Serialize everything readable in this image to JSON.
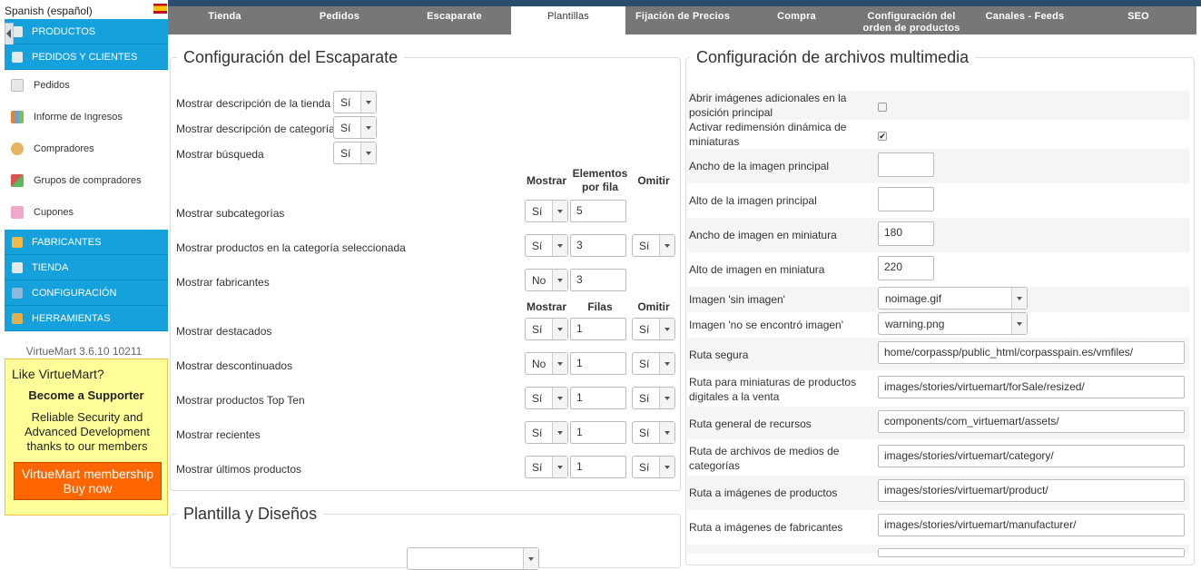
{
  "language": {
    "label": "Spanish (español)",
    "flag_icon": "spain-flag-icon"
  },
  "sidebar": {
    "products": "PRODUCTOS",
    "orders_customers": "PEDIDOS Y CLIENTES",
    "sub_items": [
      {
        "label": "Pedidos",
        "icon": "orders-icon"
      },
      {
        "label": "Informe de Ingresos",
        "icon": "chart-icon"
      },
      {
        "label": "Compradores",
        "icon": "users-icon"
      },
      {
        "label": "Grupos de compradores",
        "icon": "groups-icon"
      },
      {
        "label": "Cupones",
        "icon": "gift-icon"
      }
    ],
    "manufacturers": "FABRICANTES",
    "store": "TIENDA",
    "configuration": "CONFIGURACIÓN",
    "tools": "HERRAMIENTAS",
    "version": "VirtueMart 3.6.10 10211"
  },
  "promo": {
    "like": "Like VirtueMart?",
    "supporter": "Become a Supporter",
    "text": "Reliable Security and Advanced Development thanks to our members",
    "button": "VirtueMart membership Buy now"
  },
  "tabs": [
    "Tienda",
    "Pedidos",
    "Escaparate",
    "Plantillas",
    "Fijación de Precios",
    "Compra",
    "Configuración del orden de productos",
    "Canales - Feeds",
    "SEO"
  ],
  "active_tab": "Plantillas",
  "storefront": {
    "title": "Configuración del Escaparate",
    "rows": [
      {
        "label": "Mostrar descripción de la tienda",
        "value": "Sí"
      },
      {
        "label": "Mostrar descripción de categoría",
        "value": "Sí"
      },
      {
        "label": "Mostrar búsqueda",
        "value": "Sí"
      }
    ],
    "headers1": {
      "show": "Mostrar",
      "per_row": "Elementos por fila",
      "omit": "Omitir"
    },
    "group1": [
      {
        "label": "Mostrar subcategorías",
        "show": "Sí",
        "count": "5",
        "omit": ""
      },
      {
        "label": "Mostrar productos en la categoría seleccionada",
        "show": "Sí",
        "count": "3",
        "omit": "Sí"
      },
      {
        "label": "Mostrar fabricantes",
        "show": "No",
        "count": "3",
        "omit": ""
      }
    ],
    "headers2": {
      "show": "Mostrar",
      "rows": "Filas",
      "omit": "Omitir"
    },
    "group2": [
      {
        "label": "Mostrar destacados",
        "show": "Sí",
        "count": "1",
        "omit": "Sí"
      },
      {
        "label": "Mostrar descontinuados",
        "show": "No",
        "count": "1",
        "omit": "Sí"
      },
      {
        "label": "Mostrar productos Top Ten",
        "show": "Sí",
        "count": "1",
        "omit": "Sí"
      },
      {
        "label": "Mostrar recientes",
        "show": "Sí",
        "count": "1",
        "omit": "Sí"
      },
      {
        "label": "Mostrar últimos productos",
        "show": "Sí",
        "count": "1",
        "omit": "Sí"
      }
    ]
  },
  "templates": {
    "title": "Plantilla y Diseños"
  },
  "media": {
    "title": "Configuración de archivos multimedia",
    "open_additional": {
      "label": "Abrir imágenes adicionales en la posición principal",
      "checked": false
    },
    "dynamic_resize": {
      "label": "Activar redimensión dinámica de miniaturas",
      "checked": true
    },
    "fields": [
      {
        "label": "Ancho de la imagen principal",
        "value": ""
      },
      {
        "label": "Alto de la imagen principal",
        "value": ""
      },
      {
        "label": "Ancho de imagen en miniatura",
        "value": "180"
      },
      {
        "label": "Alto de imagen en miniatura",
        "value": "220"
      }
    ],
    "selects": [
      {
        "label": "Imagen 'sin imagen'",
        "value": "noimage.gif"
      },
      {
        "label": "Imagen 'no se encontró imagen'",
        "value": "warning.png"
      }
    ],
    "paths": [
      {
        "label": "Ruta segura",
        "value": "home/corpassp/public_html/corpasspain.es/vmfiles/"
      },
      {
        "label": "Ruta para miniaturas de productos digitales a la venta",
        "value": "images/stories/virtuemart/forSale/resized/"
      },
      {
        "label": "Ruta general de recursos",
        "value": "components/com_virtuemart/assets/"
      },
      {
        "label": "Ruta de archivos de medios de categorías",
        "value": "images/stories/virtuemart/category/"
      },
      {
        "label": "Ruta a imágenes de productos",
        "value": "images/stories/virtuemart/product/"
      },
      {
        "label": "Ruta a imágenes de fabricantes",
        "value": "images/stories/virtuemart/manufacturer/"
      }
    ]
  }
}
